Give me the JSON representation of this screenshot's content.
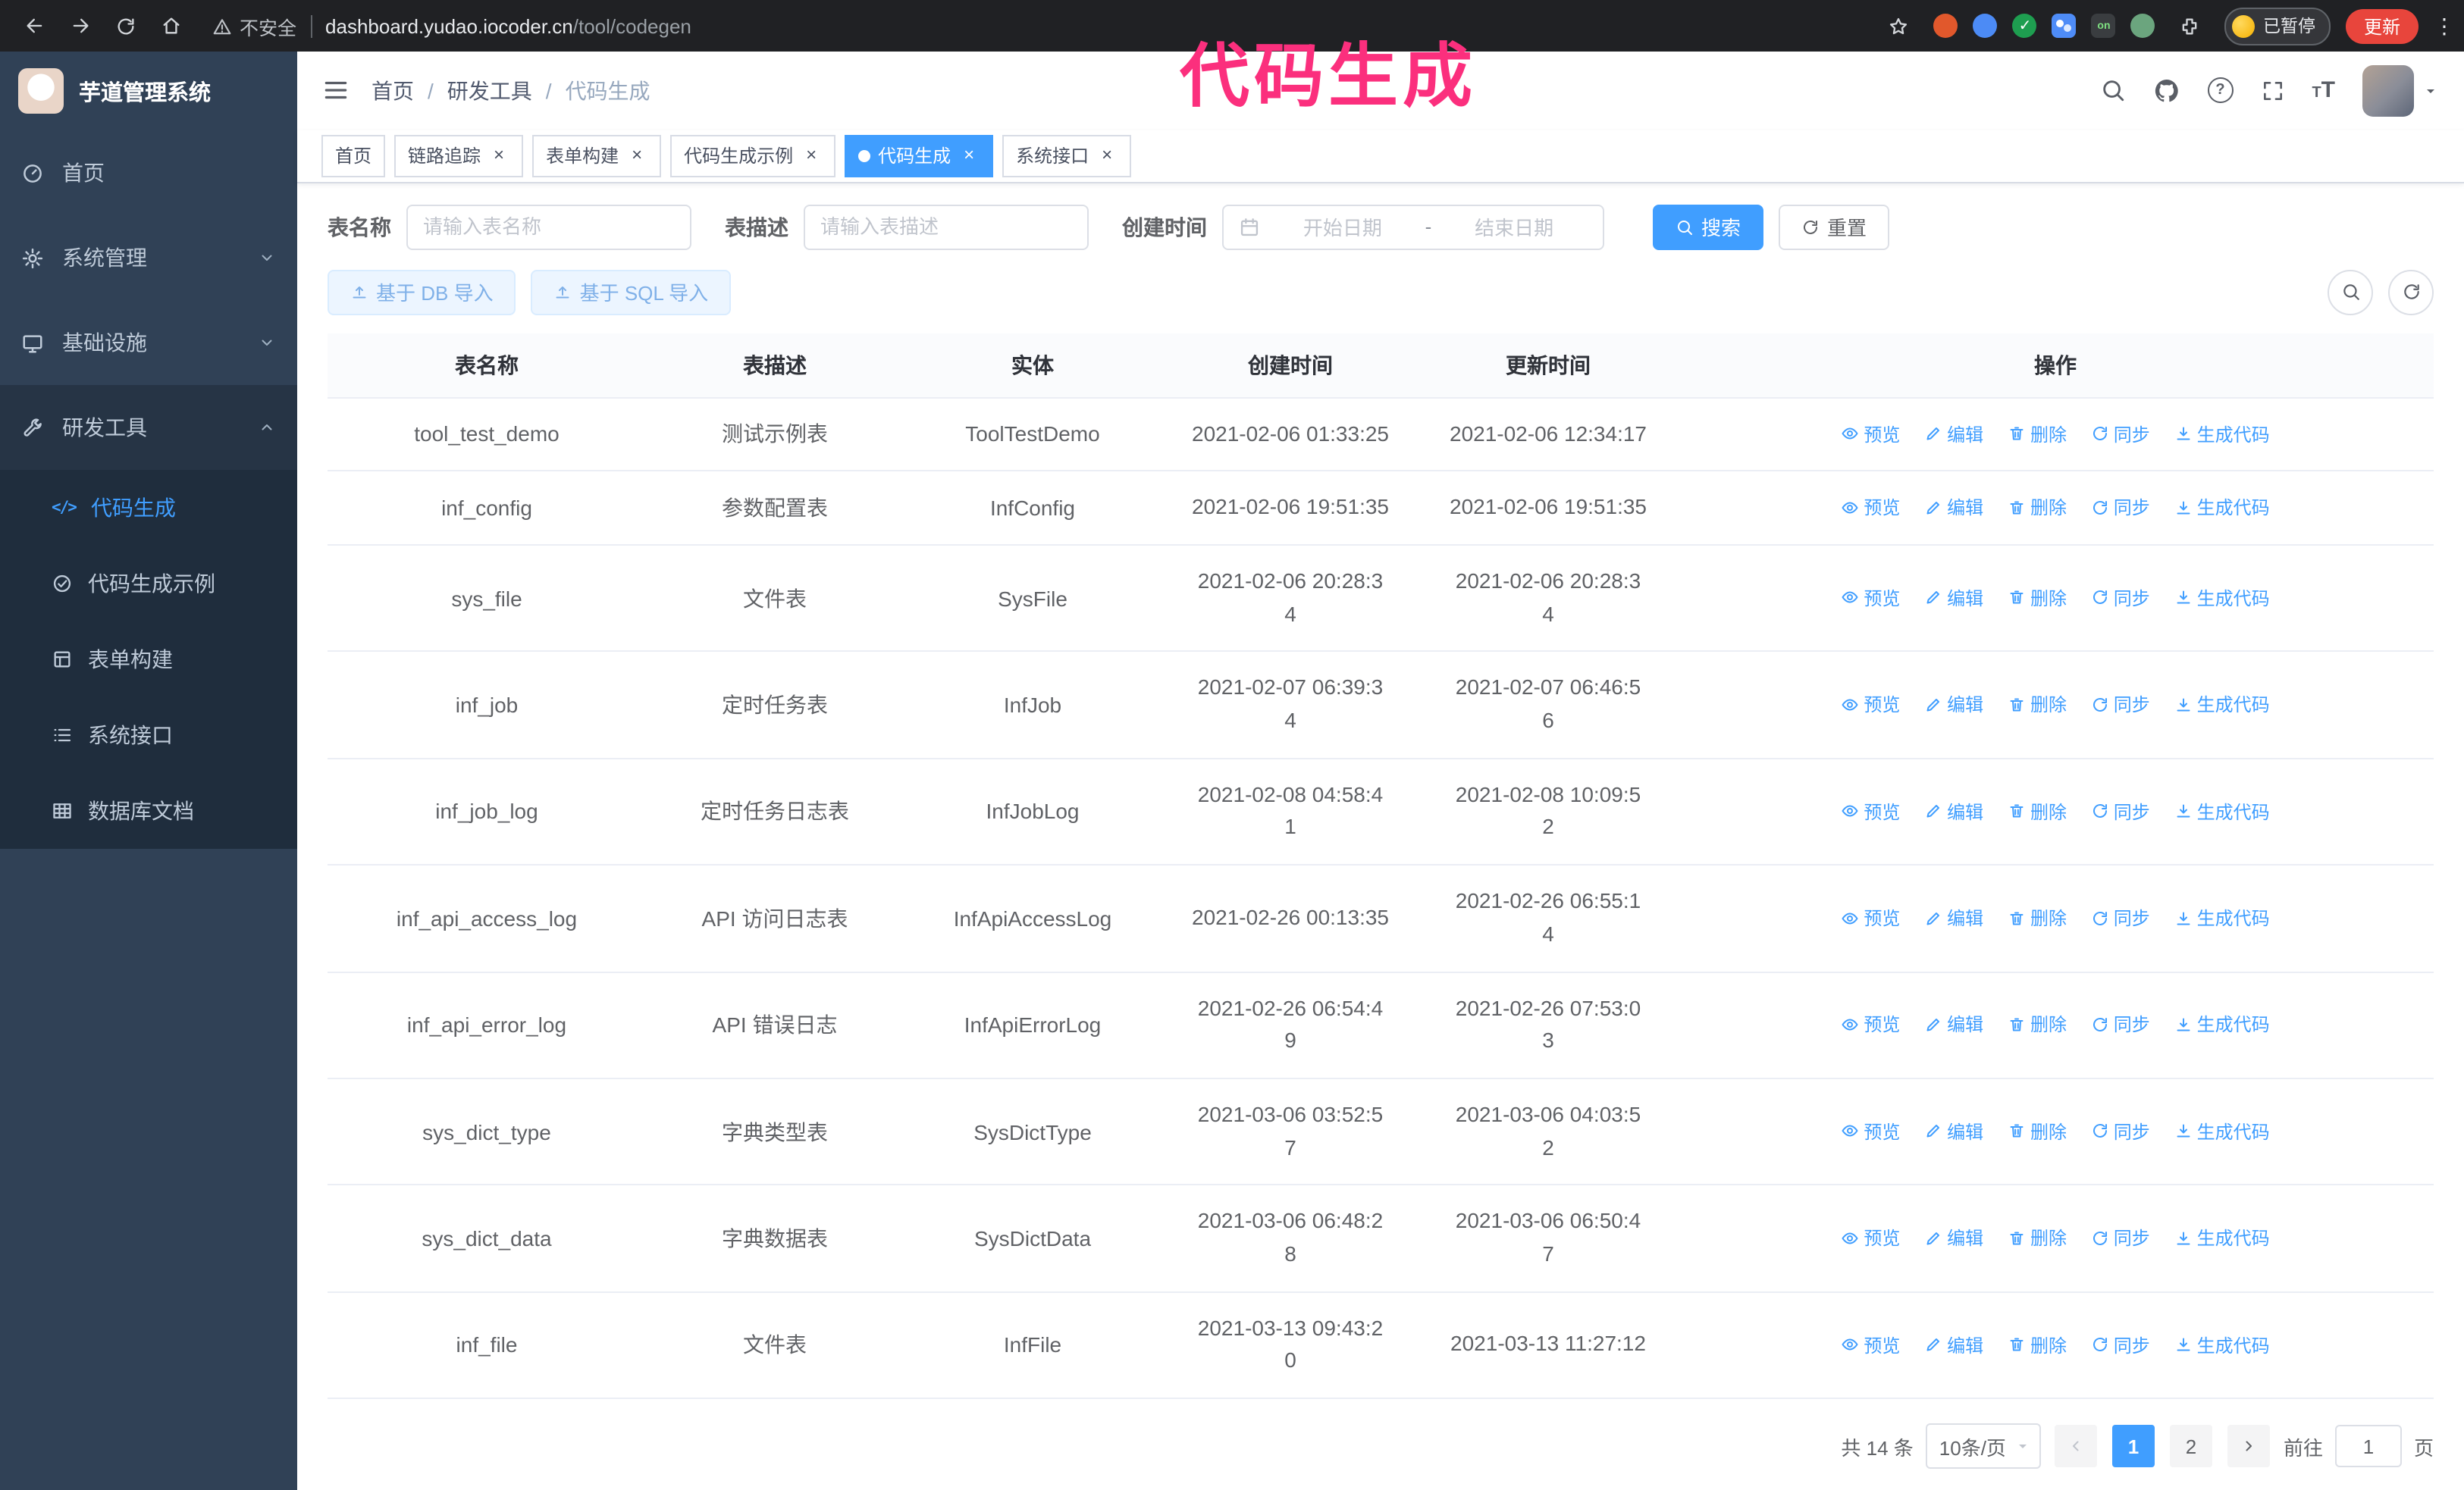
{
  "overlay_title": "代码生成",
  "colors": {
    "accent": "#409eff",
    "overlay_pink": "#fb2f7d",
    "sidebar_bg": "#304156",
    "submenu_bg": "#1f2d3d",
    "active_tab_bg": "#409eff",
    "update_button_bg": "#e8453c",
    "chrome_bg": "#202124"
  },
  "browser": {
    "security_label": "不安全",
    "url_host": "dashboard.yudao.iocoder.cn",
    "url_path": "/tool/codegen",
    "paused_badge": "已暂停",
    "update_button": "更新",
    "ext_badge_on": "on"
  },
  "icons": {
    "close": "×",
    "kebab": "⋮",
    "code": "</>",
    "question": "?",
    "font_size_big": "T",
    "font_size_small": "T",
    "breadcrumb_sep": "/",
    "date_sep": "-",
    "check": "✓"
  },
  "sidebar": {
    "app_title": "芋道管理系统",
    "items": [
      {
        "label": "首页"
      },
      {
        "label": "系统管理"
      },
      {
        "label": "基础设施"
      },
      {
        "label": "研发工具"
      }
    ],
    "submenu": [
      {
        "label": "代码生成"
      },
      {
        "label": "代码生成示例"
      },
      {
        "label": "表单构建"
      },
      {
        "label": "系统接口"
      },
      {
        "label": "数据库文档"
      }
    ]
  },
  "breadcrumb": [
    "首页",
    "研发工具",
    "代码生成"
  ],
  "tabs": [
    {
      "label": "首页"
    },
    {
      "label": "链路追踪"
    },
    {
      "label": "表单构建"
    },
    {
      "label": "代码生成示例"
    },
    {
      "label": "代码生成"
    },
    {
      "label": "系统接口"
    }
  ],
  "filters": {
    "name_label": "表名称",
    "name_placeholder": "请输入表名称",
    "desc_label": "表描述",
    "desc_placeholder": "请输入表描述",
    "time_label": "创建时间",
    "start_placeholder": "开始日期",
    "end_placeholder": "结束日期",
    "search": "搜索",
    "reset": "重置"
  },
  "toolbar": {
    "import_db": "基于 DB 导入",
    "import_sql": "基于 SQL 导入"
  },
  "table": {
    "columns": [
      "表名称",
      "表描述",
      "实体",
      "创建时间",
      "更新时间",
      "操作"
    ],
    "actions": [
      "预览",
      "编辑",
      "删除",
      "同步",
      "生成代码"
    ],
    "rows": [
      {
        "name": "tool_test_demo",
        "desc": "测试示例表",
        "entity": "ToolTestDemo",
        "created": "2021-02-06 01:33:25",
        "updated": "2021-02-06 12:34:17"
      },
      {
        "name": "inf_config",
        "desc": "参数配置表",
        "entity": "InfConfig",
        "created": "2021-02-06 19:51:35",
        "updated": "2021-02-06 19:51:35"
      },
      {
        "name": "sys_file",
        "desc": "文件表",
        "entity": "SysFile",
        "created": "2021-02-06 20:28:3\n4",
        "updated": "2021-02-06 20:28:3\n4"
      },
      {
        "name": "inf_job",
        "desc": "定时任务表",
        "entity": "InfJob",
        "created": "2021-02-07 06:39:3\n4",
        "updated": "2021-02-07 06:46:5\n6"
      },
      {
        "name": "inf_job_log",
        "desc": "定时任务日志表",
        "entity": "InfJobLog",
        "created": "2021-02-08 04:58:4\n1",
        "updated": "2021-02-08 10:09:5\n2"
      },
      {
        "name": "inf_api_access_log",
        "desc": "API 访问日志表",
        "entity": "InfApiAccessLog",
        "created": "2021-02-26 00:13:35",
        "updated": "2021-02-26 06:55:1\n4"
      },
      {
        "name": "inf_api_error_log",
        "desc": "API 错误日志",
        "entity": "InfApiErrorLog",
        "created": "2021-02-26 06:54:4\n9",
        "updated": "2021-02-26 07:53:0\n3"
      },
      {
        "name": "sys_dict_type",
        "desc": "字典类型表",
        "entity": "SysDictType",
        "created": "2021-03-06 03:52:5\n7",
        "updated": "2021-03-06 04:03:5\n2"
      },
      {
        "name": "sys_dict_data",
        "desc": "字典数据表",
        "entity": "SysDictData",
        "created": "2021-03-06 06:48:2\n8",
        "updated": "2021-03-06 06:50:4\n7"
      },
      {
        "name": "inf_file",
        "desc": "文件表",
        "entity": "InfFile",
        "created": "2021-03-13 09:43:2\n0",
        "updated": "2021-03-13 11:27:12"
      }
    ]
  },
  "pagination": {
    "total": "共 14 条",
    "page_size": "10条/页",
    "pages": [
      "1",
      "2"
    ],
    "goto_label": "前往",
    "goto_value": "1",
    "goto_suffix": "页"
  }
}
